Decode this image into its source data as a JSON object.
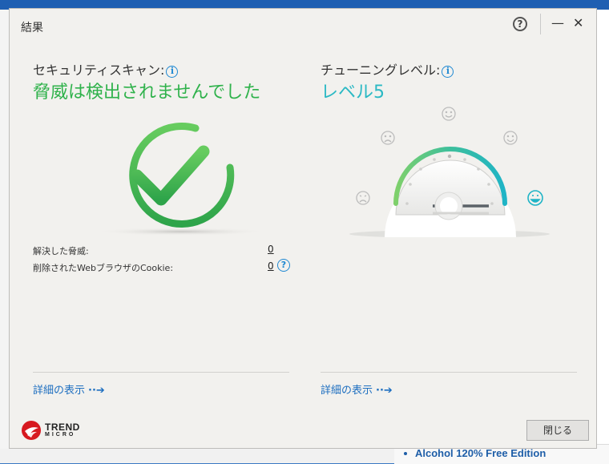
{
  "window": {
    "title": "結果"
  },
  "security": {
    "label": "セキュリティスキャン:",
    "result": "脅威は検出されませんでした",
    "stats": [
      {
        "label": "解決した脅威:",
        "value": "0"
      },
      {
        "label": "削除されたWebブラウザのCookie:",
        "value": "0"
      }
    ],
    "details_link": "詳細の表示"
  },
  "tuning": {
    "label": "チューニングレベル:",
    "level_text": "レベル5",
    "level": 5,
    "level_max": 5,
    "details_link": "詳細の表示"
  },
  "footer": {
    "brand_line1": "TREND",
    "brand_line2": "MICRO",
    "close_label": "閉じる"
  },
  "background": {
    "taskbar_item": "Alcohol 120% Free Edition"
  },
  "colors": {
    "success_green": "#2fb24b",
    "tuning_teal": "#2bb9c4",
    "link_blue": "#1e6fc0",
    "brand_red": "#d71920"
  }
}
